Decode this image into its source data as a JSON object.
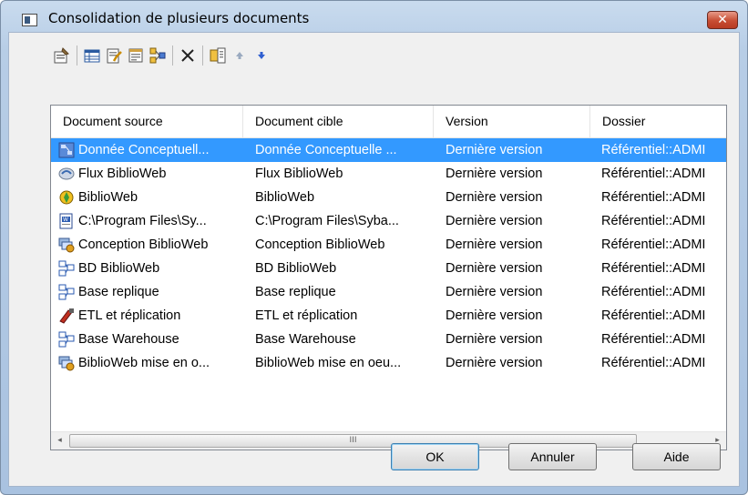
{
  "window": {
    "title": "Consolidation de plusieurs documents",
    "close_label": "✕"
  },
  "columns": [
    "Document source",
    "Document cible",
    "Version",
    "Dossier"
  ],
  "rows": [
    {
      "source": "Donnée Conceptuell...",
      "target": "Donnée Conceptuelle ...",
      "version": "Dernière version",
      "folder": "Référentiel::ADMI",
      "icon": "data-model-icon"
    },
    {
      "source": "Flux BiblioWeb",
      "target": "Flux BiblioWeb",
      "version": "Dernière version",
      "folder": "Référentiel::ADMI",
      "icon": "flow-icon"
    },
    {
      "source": "BiblioWeb",
      "target": "BiblioWeb",
      "version": "Dernière version",
      "folder": "Référentiel::ADMI",
      "icon": "project-icon"
    },
    {
      "source": "C:\\Program Files\\Sy...",
      "target": "C:\\Program Files\\Syba...",
      "version": "Dernière version",
      "folder": "Référentiel::ADMI",
      "icon": "word-document-icon"
    },
    {
      "source": "Conception BiblioWeb",
      "target": "Conception BiblioWeb",
      "version": "Dernière version",
      "folder": "Référentiel::ADMI",
      "icon": "design-model-icon"
    },
    {
      "source": "BD BiblioWeb",
      "target": "BD BiblioWeb",
      "version": "Dernière version",
      "folder": "Référentiel::ADMI",
      "icon": "database-model-icon"
    },
    {
      "source": "Base replique",
      "target": "Base replique",
      "version": "Dernière version",
      "folder": "Référentiel::ADMI",
      "icon": "database-model-icon"
    },
    {
      "source": "ETL et réplication",
      "target": "ETL et réplication",
      "version": "Dernière version",
      "folder": "Référentiel::ADMI",
      "icon": "etl-icon"
    },
    {
      "source": "Base Warehouse",
      "target": "Base Warehouse",
      "version": "Dernière version",
      "folder": "Référentiel::ADMI",
      "icon": "database-model-icon"
    },
    {
      "source": "BiblioWeb mise en o...",
      "target": "BiblioWeb mise en oeu...",
      "version": "Dernière version",
      "folder": "Référentiel::ADMI",
      "icon": "design-model-icon"
    }
  ],
  "scrollbar": {
    "left": "◂",
    "grip": "III",
    "right": "▸"
  },
  "buttons": {
    "ok": "OK",
    "cancel": "Annuler",
    "help": "Aide"
  },
  "colors": {
    "selection": "#3399ff",
    "accent_arrow": "#2f5fd0"
  }
}
